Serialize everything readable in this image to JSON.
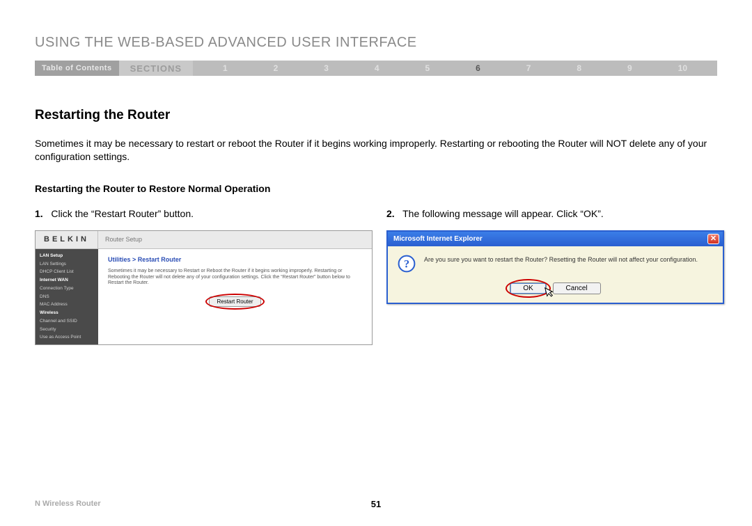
{
  "header": {
    "main_title": "USING THE WEB-BASED ADVANCED USER INTERFACE"
  },
  "nav": {
    "toc_label": "Table of Contents",
    "sections_label": "SECTIONS",
    "items": [
      "1",
      "2",
      "3",
      "4",
      "5",
      "6",
      "7",
      "8",
      "9",
      "10"
    ],
    "active_index": 5
  },
  "content": {
    "section_heading": "Restarting the Router",
    "intro": "Sometimes it may be necessary to restart or reboot the Router if it begins working improperly. Restarting or rebooting the Router will NOT delete any of your configuration settings.",
    "sub_heading": "Restarting the Router to Restore Normal Operation",
    "step1_num": "1.",
    "step1_text": "Click the “Restart Router” button.",
    "step2_num": "2.",
    "step2_text": "The following message will appear. Click “OK”."
  },
  "belkin": {
    "logo": "BELKIN",
    "subtitle": "Router Setup",
    "sidebar": [
      {
        "label": "LAN Setup",
        "head": true
      },
      {
        "label": "LAN Settings",
        "head": false
      },
      {
        "label": "DHCP Client List",
        "head": false
      },
      {
        "label": "Internet WAN",
        "head": true
      },
      {
        "label": "Connection Type",
        "head": false
      },
      {
        "label": "DNS",
        "head": false
      },
      {
        "label": "MAC Address",
        "head": false
      },
      {
        "label": "Wireless",
        "head": true
      },
      {
        "label": "Channel and SSID",
        "head": false
      },
      {
        "label": "Security",
        "head": false
      },
      {
        "label": "Use as Access Point",
        "head": false
      }
    ],
    "breadcrumb": "Utilities > Restart Router",
    "desc": "Sometimes it may be necessary to Restart or Reboot the Router if it begins working improperly. Restarting or Rebooting the Router will not delete any of your configuration settings. Click the “Restart Router” button below to Restart the Router.",
    "restart_label": "Restart Router"
  },
  "dialog": {
    "title": "Microsoft Internet Explorer",
    "close_glyph": "✕",
    "message": "Are you sure you want to restart the Router? Resetting the Router will not affect your configuration.",
    "ok_label": "OK",
    "cancel_label": "Cancel"
  },
  "footer": {
    "product": "N Wireless Router",
    "page_number": "51"
  }
}
